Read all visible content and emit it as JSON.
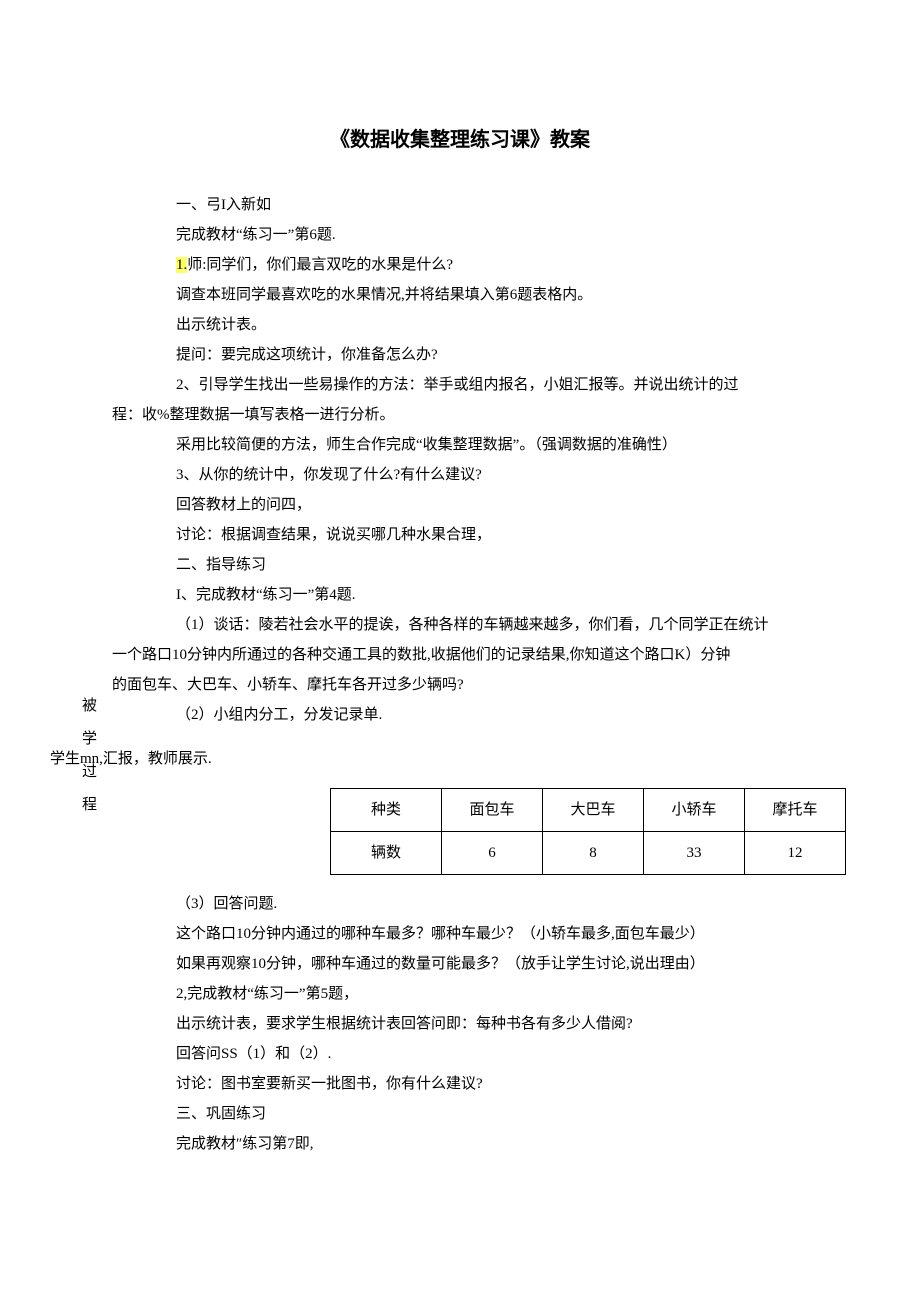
{
  "title": "《数据收集整理练习课》教案",
  "side_label": [
    "被",
    "学",
    "过",
    "程"
  ],
  "lines": {
    "l1": "一、弓I入新如",
    "l2": "完成教材“练习一”第6题.",
    "l3a": "1.",
    "l3b": "师:同学们，你们最言双吃的水果是什么?",
    "l4": "调查本班同学最喜欢吃的水果情况,并将结果填入第6题表格内。",
    "l5": "出示统计表。",
    "l6": "提问：要完成这项统计，你准备怎么办?",
    "l7": "2、引导学生找出一些易操作的方法：举手或组内报名，小姐汇报等。并说出统计的过",
    "l7w": "程：收%整理数据一填写表格一进行分析。",
    "l8": "采用比较简便的方法，师生合作完成“收集整理数据”。（强调数据的准确性）",
    "l9": "3、从你的统计中，你发现了什么?有什么建议?",
    "l10": "回答教材上的问四，",
    "l11": "讨论：根据调查结果，说说买哪几种水果合理，",
    "l12": "二、指导练习",
    "l13": "I、完成教材“练习一”第4题.",
    "l14": "（1）谈话：陵若社会水平的提诶，各种各样的车辆越来越多，你们看，几个同学正在统计",
    "l14w1": "一个路口10分钟内所通过的各种交通工具的数批,收据他们的记录结果,你知道这个路口K）分钟",
    "l14w2": "的面包车、大巴车、小轿车、摩托车各开过多少辆吗?",
    "l15": "（2）小组内分工，分发记录单.",
    "extra": "学生mn,汇报，教师展示.",
    "l16": "（3）回答问题.",
    "l17": "这个路口10分钟内通过的哪种车最多？哪种车最少？（小轿车最多,面包车最少）",
    "l18": "如果再观察10分钟，哪种车通过的数量可能最多？（放手让学生讨论,说出理由）",
    "l19": "2,完成教材“练习一”第5题，",
    "l20": "出示统计表，要求学生根据统计表回答问即：每种书各有多少人借阅?",
    "l21": "回答问SS（1）和（2）.",
    "l22": "讨论：图书室要新买一批图书，你有什么建议?",
    "l23": "三、巩固练习",
    "l24": "完成教材″练习第7即,"
  },
  "table": {
    "headers": [
      "种类",
      "面包车",
      "大巴车",
      "小轿车",
      "摩托车"
    ],
    "rowlabel": "辆数",
    "values": [
      "6",
      "8",
      "33",
      "12"
    ]
  }
}
